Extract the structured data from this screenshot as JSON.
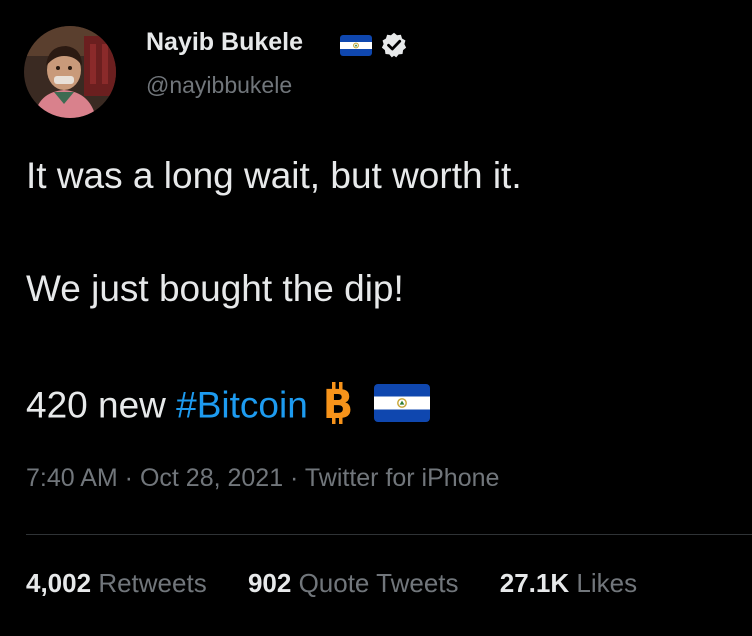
{
  "author": {
    "display_name": "Nayib Bukele",
    "handle": "@nayibbukele",
    "flag_icon": "el-salvador-flag-icon",
    "verified_icon": "verified-badge-icon"
  },
  "tweet": {
    "line1": "It was a long wait, but worth it.",
    "line2": "We just bought the dip!",
    "line3_prefix": "420 new ",
    "hashtag": "#Bitcoin"
  },
  "meta": {
    "time": "7:40 AM",
    "sep1": " · ",
    "date": "Oct 28, 2021",
    "sep2": " · ",
    "source": "Twitter for iPhone"
  },
  "stats": {
    "retweets_count": "4,002",
    "retweets_label": "Retweets",
    "quotes_count": "902",
    "quotes_label": "Quote Tweets",
    "likes_count": "27.1K",
    "likes_label": "Likes"
  },
  "colors": {
    "background": "#000000",
    "text": "#e7e9ea",
    "muted": "#71767b",
    "link": "#1d9bf0",
    "bitcoin": "#f7931a",
    "flag_blue": "#0f47af"
  }
}
